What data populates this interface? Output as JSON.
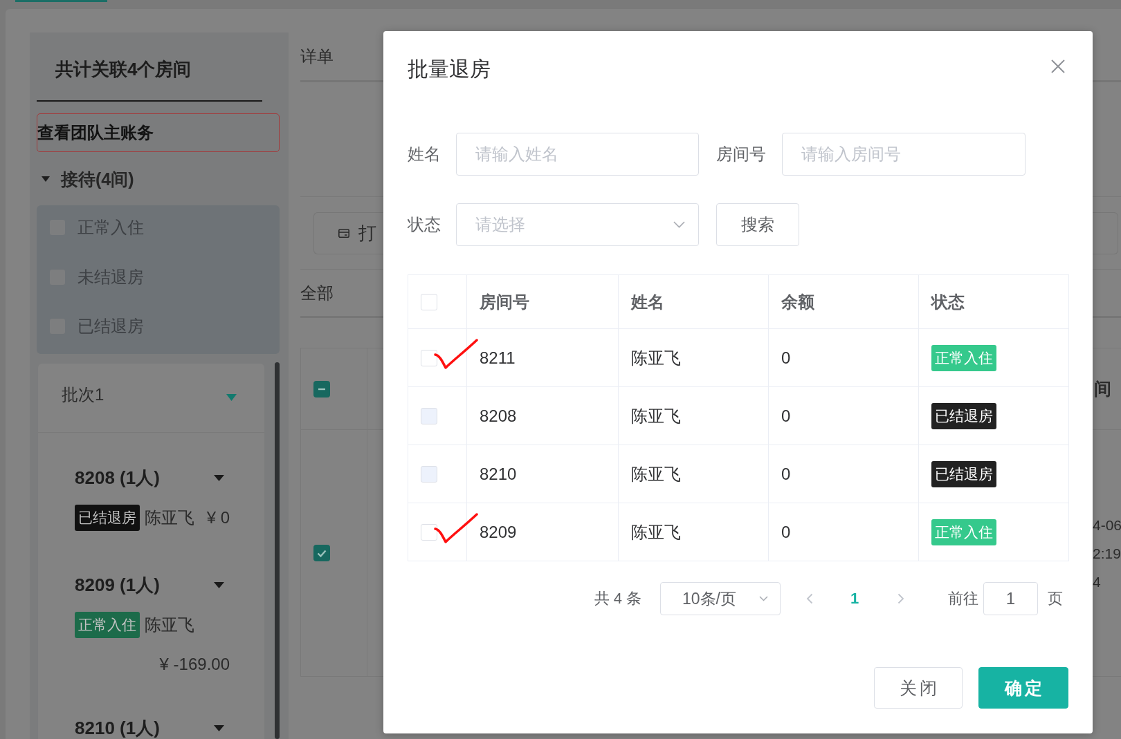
{
  "sidebar": {
    "title": "共计关联4个房间",
    "team_account_link": "查看团队主账务",
    "group": {
      "label": "接待(4间)",
      "expanded": true,
      "filters": [
        {
          "label": "正常入住",
          "checked": false
        },
        {
          "label": "未结退房",
          "checked": false
        },
        {
          "label": "已结退房",
          "checked": false
        }
      ]
    },
    "batches": [
      {
        "label": "批次1",
        "expanded": true,
        "rooms": [
          {
            "title": "8208 (1人)",
            "expanded": true,
            "guests": [
              {
                "status": {
                  "text": "已结退房",
                  "color": "#111111"
                },
                "name": "陈亚飞",
                "balance": "¥ 0"
              }
            ]
          },
          {
            "title": "8209 (1人)",
            "expanded": true,
            "guests": [
              {
                "status": {
                  "text": "正常入住",
                  "color": "#1c6b4a"
                },
                "name": "陈亚飞",
                "balance": "¥ -169.00"
              }
            ]
          },
          {
            "title": "8210 (1人)",
            "expanded": true
          }
        ]
      }
    ]
  },
  "main": {
    "tab": "详单",
    "print_button": "打",
    "filter_tab": "全部",
    "table": {
      "select_all": {
        "indeterminate": true
      },
      "header_fragment": "间",
      "rows": [
        {
          "checked": true,
          "fragments": [
            "4-06",
            "2:19",
            "4"
          ]
        }
      ]
    }
  },
  "dialog": {
    "title": "批量退房",
    "fields": [
      {
        "kind": "input",
        "label": "姓名",
        "placeholder": "请输入姓名"
      },
      {
        "kind": "input",
        "label": "房间号",
        "placeholder": "请输入房间号"
      },
      {
        "kind": "select",
        "label": "状态",
        "placeholder": "请选择"
      }
    ],
    "search_button": "搜索",
    "table": {
      "columns": [
        "房间号",
        "姓名",
        "余额",
        "状态"
      ],
      "select_all": {
        "checked": false
      },
      "rows": [
        {
          "checked": false,
          "disabled": false,
          "marked": true,
          "room": "8211",
          "name": "陈亚飞",
          "balance": "0",
          "status": {
            "text": "正常入住",
            "color": "#35c98c"
          }
        },
        {
          "checked": false,
          "disabled": true,
          "marked": false,
          "room": "8208",
          "name": "陈亚飞",
          "balance": "0",
          "status": {
            "text": "已结退房",
            "color": "#222222"
          }
        },
        {
          "checked": false,
          "disabled": true,
          "marked": false,
          "room": "8210",
          "name": "陈亚飞",
          "balance": "0",
          "status": {
            "text": "已结退房",
            "color": "#222222"
          }
        },
        {
          "checked": false,
          "disabled": false,
          "marked": true,
          "room": "8209",
          "name": "陈亚飞",
          "balance": "0",
          "status": {
            "text": "正常入住",
            "color": "#35c98c"
          }
        }
      ]
    },
    "pagination": {
      "total": "共 4 条",
      "page_size": "10条/页",
      "prev": {
        "disabled": true
      },
      "pages": [
        {
          "label": "1",
          "selected": true
        }
      ],
      "next": {
        "disabled": true
      },
      "goto_label": "前往",
      "goto_value": "1",
      "goto_suffix": "页"
    },
    "buttons": [
      {
        "label": "关闭",
        "kind": "default"
      },
      {
        "label": "确定",
        "kind": "primary"
      }
    ]
  }
}
